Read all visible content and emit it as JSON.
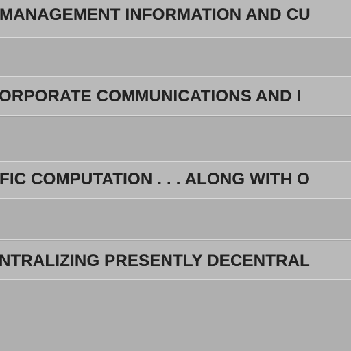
{
  "document": {
    "lines": [
      "MANAGEMENT INFORMATION AND CU",
      "ORPORATE COMMUNICATIONS AND I",
      "FIC COMPUTATION . . . ALONG WITH O",
      "NTRALIZING PRESENTLY DECENTRAL"
    ]
  }
}
